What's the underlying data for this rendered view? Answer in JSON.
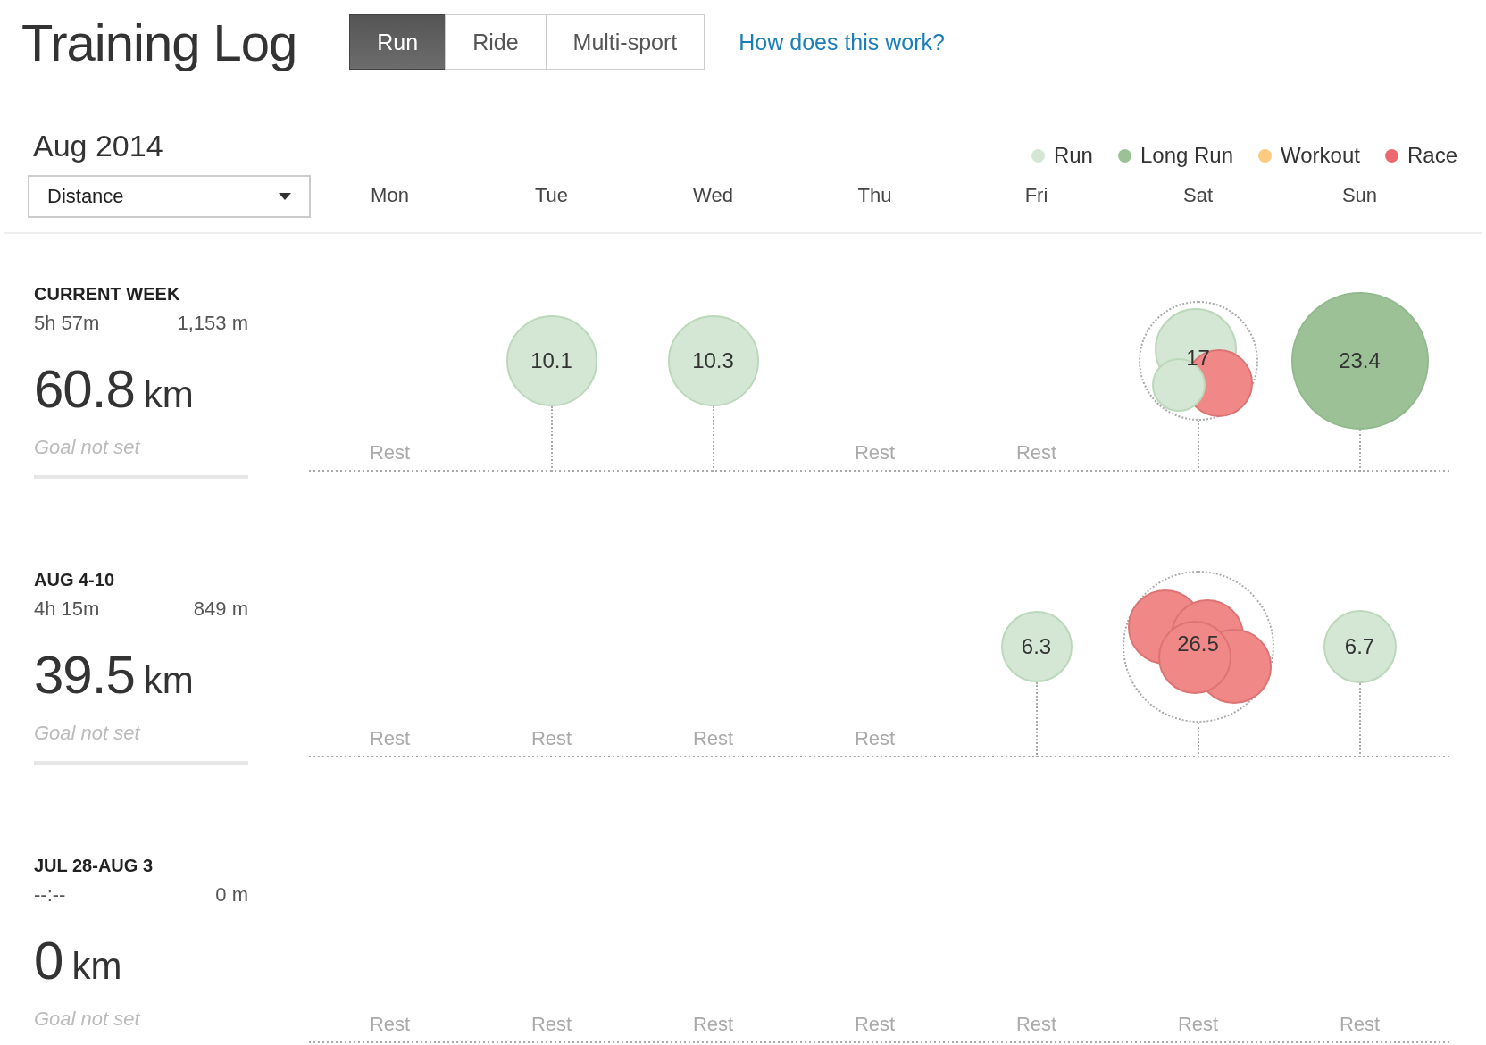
{
  "title": "Training Log",
  "tabs": [
    {
      "label": "Run",
      "selected": true
    },
    {
      "label": "Ride",
      "selected": false
    },
    {
      "label": "Multi-sport",
      "selected": false
    }
  ],
  "help_link": "How does this work?",
  "month": "Aug 2014",
  "metric_select": {
    "value": "Distance"
  },
  "legend": [
    {
      "label": "Run",
      "color": "#d4e7d4"
    },
    {
      "label": "Long Run",
      "color": "#9cc197"
    },
    {
      "label": "Workout",
      "color": "#fdcb7f"
    },
    {
      "label": "Race",
      "color": "#ec6a6f"
    }
  ],
  "days": [
    "Mon",
    "Tue",
    "Wed",
    "Thu",
    "Fri",
    "Sat",
    "Sun"
  ],
  "weeks": [
    {
      "label": "CURRENT WEEK",
      "time": "5h 57m",
      "elevation": "1,153 m",
      "distance": "60.8",
      "unit": "km",
      "goal": "Goal not set",
      "days": [
        {
          "kind": "rest",
          "label": "Rest"
        },
        {
          "kind": "activity",
          "total": "10.1",
          "activities": [
            {
              "kind": "run"
            }
          ]
        },
        {
          "kind": "activity",
          "total": "10.3",
          "activities": [
            {
              "kind": "run"
            }
          ]
        },
        {
          "kind": "rest",
          "label": "Rest"
        },
        {
          "kind": "rest",
          "label": "Rest"
        },
        {
          "kind": "activity",
          "total": "17",
          "activities": [
            {
              "kind": "run"
            },
            {
              "kind": "race"
            },
            {
              "kind": "run"
            }
          ]
        },
        {
          "kind": "activity",
          "total": "23.4",
          "activities": [
            {
              "kind": "long_run"
            }
          ]
        }
      ]
    },
    {
      "label": "AUG 4-10",
      "time": "4h 15m",
      "elevation": "849 m",
      "distance": "39.5",
      "unit": "km",
      "goal": "Goal not set",
      "days": [
        {
          "kind": "rest",
          "label": "Rest"
        },
        {
          "kind": "rest",
          "label": "Rest"
        },
        {
          "kind": "rest",
          "label": "Rest"
        },
        {
          "kind": "rest",
          "label": "Rest"
        },
        {
          "kind": "activity",
          "total": "6.3",
          "activities": [
            {
              "kind": "run"
            }
          ]
        },
        {
          "kind": "activity",
          "total": "26.5",
          "activities": [
            {
              "kind": "race"
            },
            {
              "kind": "race"
            },
            {
              "kind": "race"
            },
            {
              "kind": "race"
            }
          ]
        },
        {
          "kind": "activity",
          "total": "6.7",
          "activities": [
            {
              "kind": "run"
            }
          ]
        }
      ]
    },
    {
      "label": "JUL 28-AUG 3",
      "time": "--:--",
      "elevation": "0 m",
      "distance": "0",
      "unit": "km",
      "goal": "Goal not set",
      "days": [
        {
          "kind": "rest",
          "label": "Rest"
        },
        {
          "kind": "rest",
          "label": "Rest"
        },
        {
          "kind": "rest",
          "label": "Rest"
        },
        {
          "kind": "rest",
          "label": "Rest"
        },
        {
          "kind": "rest",
          "label": "Rest"
        },
        {
          "kind": "rest",
          "label": "Rest"
        },
        {
          "kind": "rest",
          "label": "Rest"
        }
      ]
    }
  ]
}
